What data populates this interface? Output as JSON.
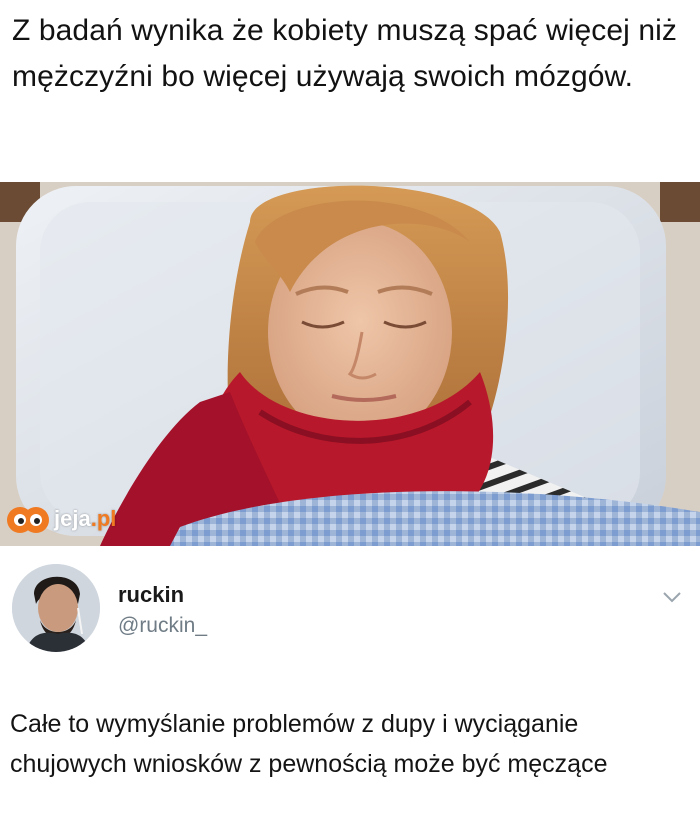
{
  "caption": "Z badań wynika że kobiety muszą spać więcej niż mężczyźni bo więcej używają swoich mózgów.",
  "watermark": {
    "text_main": "jeja",
    "text_dot": ".pl",
    "icon": "jeja-logo-icon",
    "accent": "#f07a22"
  },
  "tweet": {
    "display_name": "ruckin",
    "handle": "@ruckin_",
    "menu_icon": "chevron-down-icon",
    "body": "Całe to wymyślanie problemów z dupy i wyciąganie chujowych wniosków z pewnością może być męczące"
  },
  "colors": {
    "handle": "#6f7c86",
    "scarf": "#b8182b",
    "hair": "#c98a4b"
  }
}
